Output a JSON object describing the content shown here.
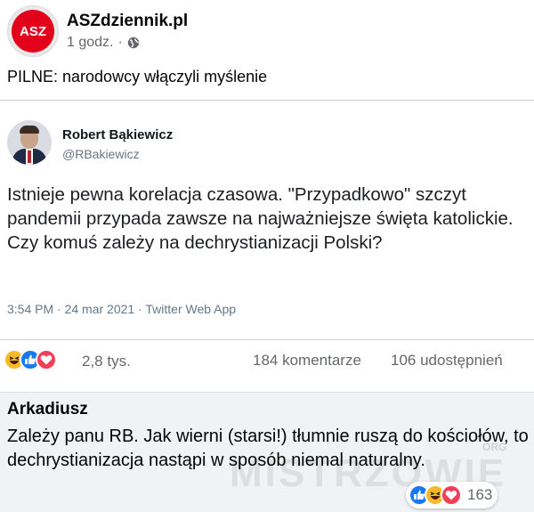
{
  "post": {
    "page_name": "ASZdziennik.pl",
    "avatar_text": "ASZ",
    "time": "1 godz.",
    "separator": "·",
    "privacy_icon": "globe-icon",
    "text": "PILNE: narodowcy włączyli myślenie"
  },
  "tweet": {
    "author_name": "Robert Bąkiewicz",
    "handle": "@RBakiewicz",
    "body_lines": [
      "Istnieje pewna korelacja czasowa. \"Przypadkowo\" szczyt pandemii przypada zawsze na najważniejsze święta katolickie.",
      "Czy komuś zależy na dechrystianizacji Polski?"
    ],
    "meta": "3:54 PM · 24 mar 2021 · Twitter Web App"
  },
  "engagement": {
    "reaction_icons": [
      "haha-reaction-icon",
      "like-reaction-icon",
      "love-reaction-icon"
    ],
    "reaction_count": "2,8 tys.",
    "comments": "184 komentarze",
    "shares": "106 udostępnień"
  },
  "comment": {
    "author": "Arkadiusz",
    "text": "Zależy panu RB. Jak wierni (starsi!) tłumnie ruszą do kościołów, to dechrystianizacja nastąpi w sposób niemal naturalny.",
    "reaction_icons": [
      "like-reaction-icon",
      "haha-reaction-icon",
      "love-reaction-icon"
    ],
    "reaction_count": "163"
  },
  "watermark": {
    "text": "MISTRZOWIE",
    "small": "ORG"
  },
  "colors": {
    "brand_red": "#e2001a",
    "facebook_blue": "#1877f2",
    "haha_yellow": "#f7b928",
    "love_red": "#f33e58",
    "secondary_text": "#65676b",
    "comment_bg": "#f0f2f5"
  }
}
